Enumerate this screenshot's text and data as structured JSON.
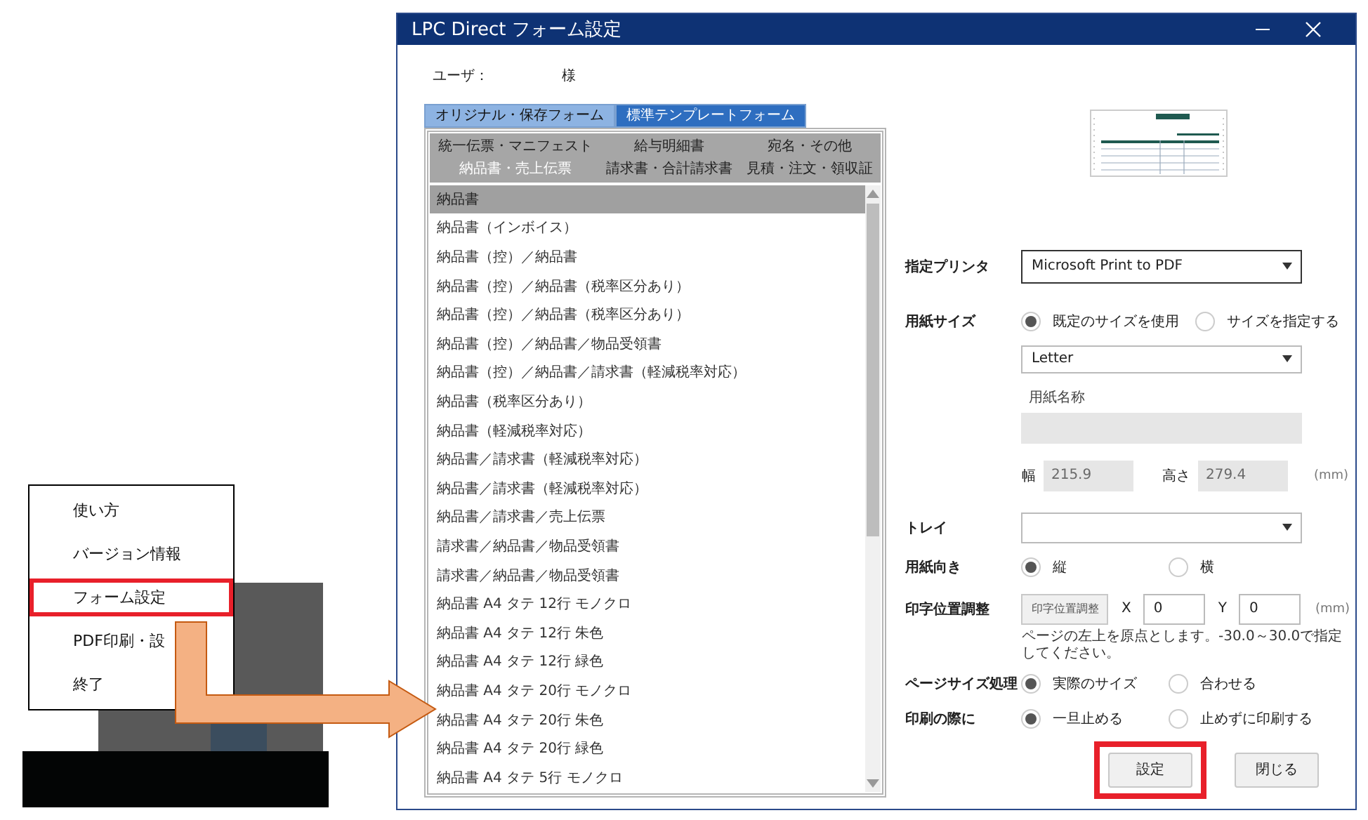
{
  "context_menu": {
    "items": [
      {
        "label": "使い方",
        "annotated": false
      },
      {
        "label": "バージョン情報",
        "annotated": false
      },
      {
        "label": "フォーム設定",
        "annotated": true
      },
      {
        "label": "PDF印刷・設",
        "annotated": false
      },
      {
        "label": "終了",
        "annotated": false
      }
    ]
  },
  "dialog": {
    "title": "LPC Direct フォーム設定",
    "user_label": "ユーザ：",
    "user_suffix": "様",
    "tabs": [
      {
        "label": "オリジナル・保存フォーム",
        "selected": false
      },
      {
        "label": "標準テンプレートフォーム",
        "selected": true
      }
    ],
    "categories": [
      {
        "label": "統一伝票・マニフェスト",
        "selected": false
      },
      {
        "label": "給与明細書",
        "selected": false
      },
      {
        "label": "宛名・その他",
        "selected": false
      },
      {
        "label": "納品書・売上伝票",
        "selected": true
      },
      {
        "label": "請求書・合計請求書",
        "selected": false
      },
      {
        "label": "見積・注文・領収証",
        "selected": false
      }
    ],
    "forms": [
      {
        "label": "納品書",
        "selected": true
      },
      {
        "label": "納品書（インボイス）",
        "selected": false
      },
      {
        "label": "納品書（控）／納品書",
        "selected": false
      },
      {
        "label": "納品書（控）／納品書（税率区分あり）",
        "selected": false
      },
      {
        "label": "納品書（控）／納品書（税率区分あり）",
        "selected": false
      },
      {
        "label": "納品書（控）／納品書／物品受領書",
        "selected": false
      },
      {
        "label": "納品書（控）／納品書／請求書（軽減税率対応）",
        "selected": false
      },
      {
        "label": "納品書（税率区分あり）",
        "selected": false
      },
      {
        "label": "納品書（軽減税率対応）",
        "selected": false
      },
      {
        "label": "納品書／請求書（軽減税率対応）",
        "selected": false
      },
      {
        "label": "納品書／請求書（軽減税率対応）",
        "selected": false
      },
      {
        "label": "納品書／請求書／売上伝票",
        "selected": false
      },
      {
        "label": "請求書／納品書／物品受領書",
        "selected": false
      },
      {
        "label": "請求書／納品書／物品受領書",
        "selected": false
      },
      {
        "label": "納品書 A4 タテ 12行 モノクロ",
        "selected": false
      },
      {
        "label": "納品書 A4 タテ 12行 朱色",
        "selected": false
      },
      {
        "label": "納品書 A4 タテ 12行 緑色",
        "selected": false
      },
      {
        "label": "納品書 A4 タテ 20行 モノクロ",
        "selected": false
      },
      {
        "label": "納品書 A4 タテ 20行 朱色",
        "selected": false
      },
      {
        "label": "納品書 A4 タテ 20行 緑色",
        "selected": false
      },
      {
        "label": "納品書 A4 タテ 5行 モノクロ",
        "selected": false
      }
    ],
    "printer": {
      "label": "指定プリンタ",
      "value": "Microsoft Print to PDF"
    },
    "paper_size": {
      "label": "用紙サイズ",
      "options": [
        {
          "label": "既定のサイズを使用",
          "selected": true
        },
        {
          "label": "サイズを指定する",
          "selected": false
        }
      ],
      "value": "Letter"
    },
    "paper_name": {
      "label": "用紙名称"
    },
    "width": {
      "label": "幅",
      "value": "215.9"
    },
    "height": {
      "label": "高さ",
      "value": "279.4"
    },
    "size_unit": "(mm)",
    "tray": {
      "label": "トレイ"
    },
    "orientation": {
      "label": "用紙向き",
      "options": [
        {
          "label": "縦",
          "selected": true
        },
        {
          "label": "横",
          "selected": false
        }
      ]
    },
    "offset": {
      "label": "印字位置調整",
      "button": "印字位置調整",
      "x_label": "X",
      "x_value": "0",
      "y_label": "Y",
      "y_value": "0",
      "unit": "(mm)",
      "hint": "ページの左上を原点とします。-30.0～30.0で指定してください。"
    },
    "page_size_handling": {
      "label": "ページサイズ処理",
      "options": [
        {
          "label": "実際のサイズ",
          "selected": true
        },
        {
          "label": "合わせる",
          "selected": false
        }
      ]
    },
    "on_print": {
      "label": "印刷の際に",
      "options": [
        {
          "label": "一旦止める",
          "selected": true
        },
        {
          "label": "止めずに印刷する",
          "selected": false
        }
      ]
    },
    "buttons": [
      {
        "label": "設定",
        "annotated": true
      },
      {
        "label": "閉じる",
        "annotated": false
      }
    ]
  }
}
